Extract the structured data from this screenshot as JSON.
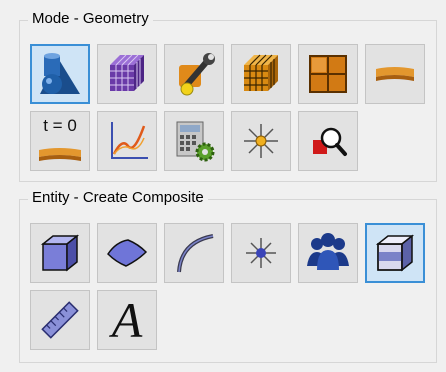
{
  "mode_group": {
    "title": "Mode - Geometry",
    "buttons": [
      {
        "name": "geometry-mode-button",
        "icon": "geometry-shapes-icon",
        "active": true
      },
      {
        "name": "mesh-mode-button",
        "icon": "purple-mesh-cube-icon",
        "active": false
      },
      {
        "name": "tools-mode-button",
        "icon": "wrench-tool-icon",
        "active": false
      },
      {
        "name": "hex-mesh-mode-button",
        "icon": "orange-mesh-cube-icon",
        "active": false
      },
      {
        "name": "grid-mode-button",
        "icon": "grid-icon",
        "active": false
      },
      {
        "name": "surface-mode-button",
        "icon": "orange-sheet-icon",
        "active": false
      },
      {
        "name": "time-step-button",
        "icon": "time-zero-sheet-icon",
        "label": "t = 0",
        "active": false
      },
      {
        "name": "plot-mode-button",
        "icon": "line-graph-icon",
        "active": false
      },
      {
        "name": "calculator-mode-button",
        "icon": "calculator-gear-icon",
        "active": false
      },
      {
        "name": "vertex-mode-button",
        "icon": "vertex-star-icon",
        "active": false
      },
      {
        "name": "inspect-mode-button",
        "icon": "magnifier-icon",
        "active": false
      }
    ]
  },
  "entity_group": {
    "title": "Entity - Create Composite",
    "buttons": [
      {
        "name": "volume-entity-button",
        "icon": "blue-cube-icon",
        "active": false
      },
      {
        "name": "surface-entity-button",
        "icon": "blue-surface-icon",
        "active": false
      },
      {
        "name": "curve-entity-button",
        "icon": "curve-icon",
        "active": false
      },
      {
        "name": "vertex-entity-button",
        "icon": "vertex-icon",
        "active": false
      },
      {
        "name": "group-entity-button",
        "icon": "people-group-icon",
        "active": false
      },
      {
        "name": "composite-entity-button",
        "icon": "composite-cube-icon",
        "active": true
      },
      {
        "name": "measure-entity-button",
        "icon": "ruler-icon",
        "active": false
      },
      {
        "name": "text-entity-button",
        "icon": "text-a-icon",
        "label": "A",
        "active": false
      }
    ]
  }
}
